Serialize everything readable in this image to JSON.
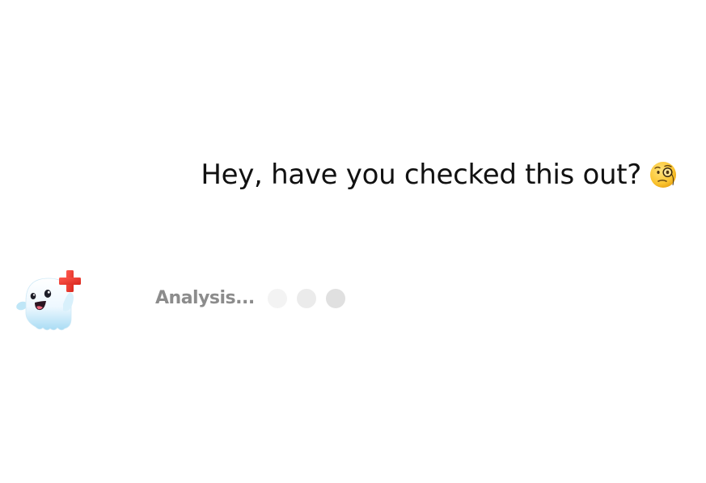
{
  "chat": {
    "user_message": {
      "text": "Hey, have you checked this out?",
      "emoji_icon": "face-with-monocle-icon"
    },
    "bot": {
      "avatar_icon": "ghost-medic-icon",
      "status_text": "Analysis...",
      "typing_indicator_dots": 3
    }
  },
  "colors": {
    "background": "#ffffff",
    "user_text": "#111111",
    "status_text": "#8c8c8c",
    "dot": "#e6e6e6",
    "cross_red": "#e53935"
  }
}
